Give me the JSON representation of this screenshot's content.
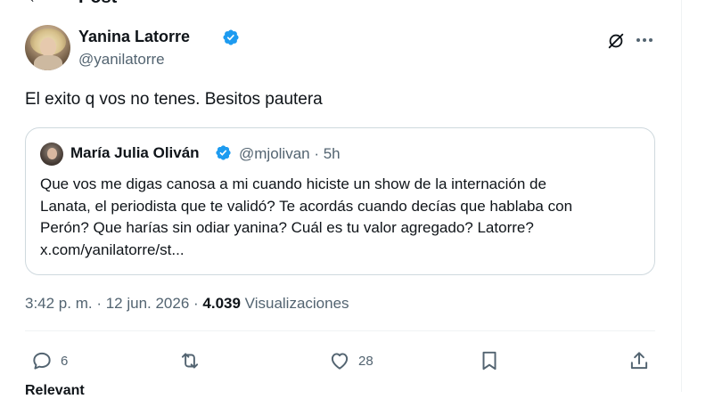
{
  "header": {
    "back_icon": "arrow-left-icon",
    "title": "Post"
  },
  "author": {
    "display_name": "Yanina Latorre",
    "handle": "@yanilatorre",
    "verified_color": "#1d9bf0"
  },
  "tweet": {
    "text": "El exito q vos no tenes. Besitos pautera"
  },
  "quote": {
    "display_name": "María Julia Oliván",
    "meta": "@mjolivan · 5h",
    "lines": [
      "Que vos me digas canosa a mi cuando hiciste un show de la internación de",
      "Lanata, el periodista que te validó? Te acordás cuando decías que hablaba con",
      "Perón? Que harías sin odiar yanina? Cuál es tu valor agregado? Latorre?",
      "x.com/yanilatorre/st..."
    ]
  },
  "timestamp": {
    "time": "3:42 p. m. · 12 jun. 2026 · ",
    "views_count": "4.039",
    "views_label": " Visualizaciones"
  },
  "actions": {
    "reply_count": "6",
    "like_count": "28"
  },
  "below": {
    "cut_text": "Relevant"
  },
  "colors": {
    "text_primary": "#0f1419",
    "text_secondary": "#536471",
    "border": "#cfd9de",
    "accent": "#1d9bf0"
  }
}
